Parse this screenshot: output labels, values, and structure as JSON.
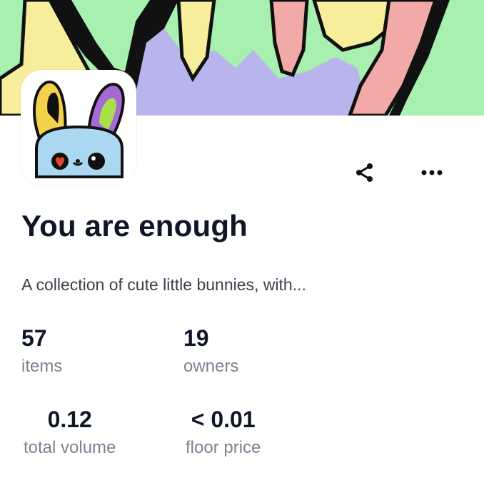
{
  "banner": {
    "colors": {
      "background": "#a8f0b0",
      "lavender": "#b8b4ec",
      "yellow": "#f6ee9a",
      "pink": "#f2aaa8",
      "outline": "#111111"
    }
  },
  "avatar": {
    "icon": "bunny-icon",
    "colors": {
      "face": "#a9d8f0",
      "ear_left": "#f2d24a",
      "ear_right": "#a66ad6",
      "heart": "#e6452c"
    }
  },
  "actions": {
    "share_icon": "share-icon",
    "more_icon": "more-horizontal-icon"
  },
  "collection": {
    "title": "You are enough",
    "description": "A collection of cute little bunnies, with..."
  },
  "stats": {
    "items": {
      "value": "57",
      "label": "items"
    },
    "owners": {
      "value": "19",
      "label": "owners"
    },
    "total_volume": {
      "value": "0.12",
      "label": "total volume"
    },
    "floor_price": {
      "value": "< 0.01",
      "label": "floor price"
    }
  }
}
